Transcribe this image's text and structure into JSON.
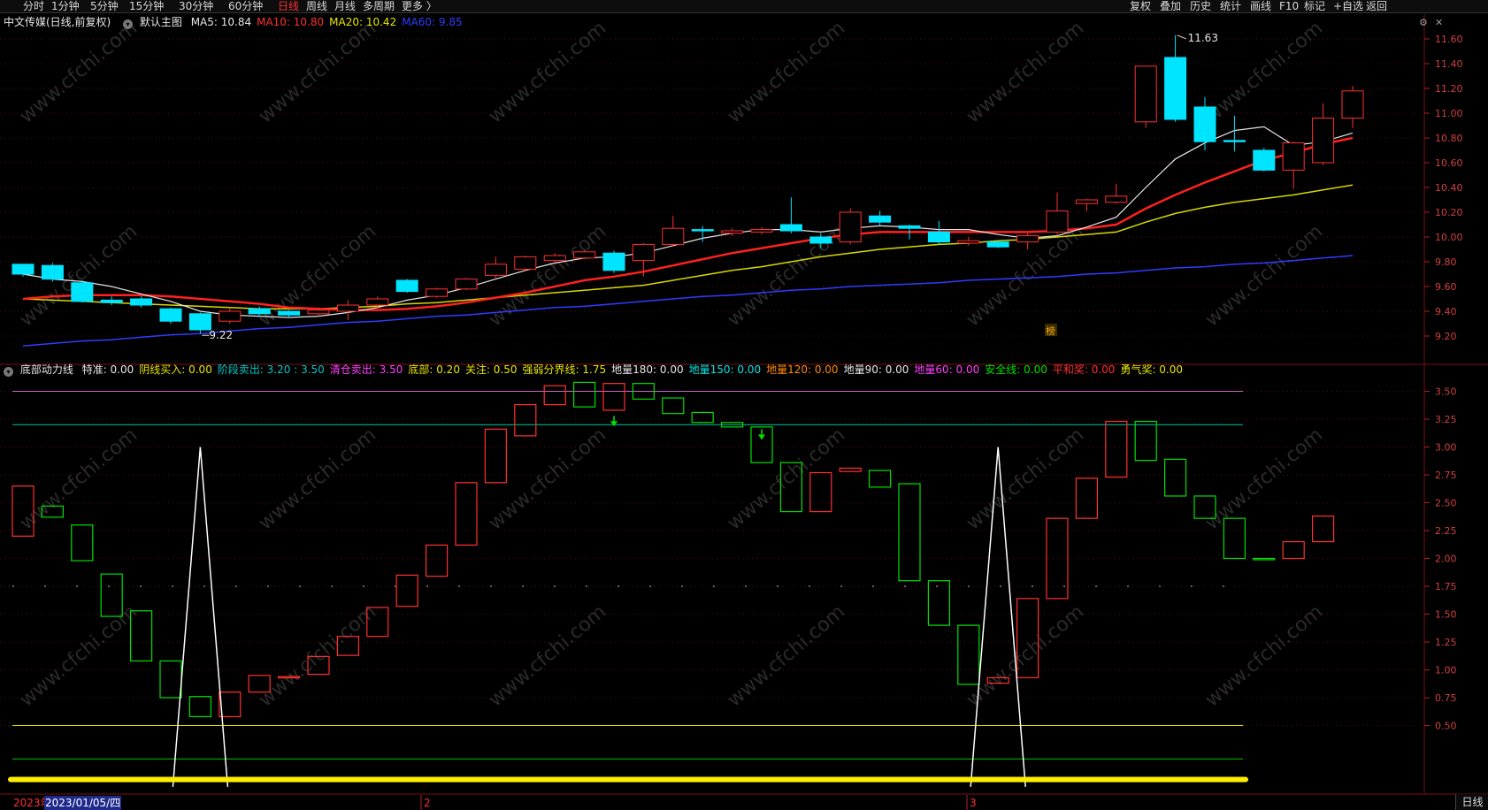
{
  "toolbar": {
    "periods": [
      "分时",
      "1分钟",
      "5分钟",
      "15分钟",
      "30分钟",
      "60分钟",
      "日线",
      "周线",
      "月线",
      "多周期",
      "更多 〉"
    ],
    "active_period": "日线",
    "right": [
      "复权",
      "叠加",
      "历史",
      "统计",
      "画线",
      "F10",
      "标记",
      "+自选",
      "返回"
    ]
  },
  "info": {
    "title": "中文传媒(日线,前复权)",
    "template": "默认主图",
    "ma": [
      {
        "label": "MA5: 10.84",
        "color": "#e6e6e6"
      },
      {
        "label": "MA10: 10.80",
        "color": "#ff3030"
      },
      {
        "label": "MA20: 10.42",
        "color": "#e6e600"
      },
      {
        "label": "MA60: 9.85",
        "color": "#2f3cff"
      }
    ]
  },
  "indicator": {
    "name": "底部动力线",
    "items": [
      {
        "label": "特准: 0.00",
        "color": "#e6e6e6"
      },
      {
        "label": "阴线买入: 0.00",
        "color": "#e6e600"
      },
      {
        "label": "阶段卖出: 3.20 : 3.50",
        "color": "#00c8c8"
      },
      {
        "label": "清仓卖出: 3.50",
        "color": "#ff40ff"
      },
      {
        "label": "底部: 0.20",
        "color": "#e6e600"
      },
      {
        "label": "关注: 0.50",
        "color": "#e6e600"
      },
      {
        "label": "强弱分界线: 1.75",
        "color": "#e6e600"
      },
      {
        "label": "地量180: 0.00",
        "color": "#e6e6e6"
      },
      {
        "label": "地量150: 0.00",
        "color": "#00e5e5"
      },
      {
        "label": "地量120: 0.00",
        "color": "#ff8c00"
      },
      {
        "label": "地量90: 0.00",
        "color": "#e6e6e6"
      },
      {
        "label": "地量60: 0.00",
        "color": "#ff40ff"
      },
      {
        "label": "安全线: 0.00",
        "color": "#00e000"
      },
      {
        "label": "平和奖: 0.00",
        "color": "#ff3030"
      },
      {
        "label": "勇气奖: 0.00",
        "color": "#e6e600"
      }
    ]
  },
  "price_axis": [
    "11.60",
    "11.40",
    "11.20",
    "11.00",
    "10.80",
    "10.60",
    "10.40",
    "10.20",
    "10.00",
    "9.80",
    "9.60",
    "9.40",
    "9.20"
  ],
  "ind_axis": [
    "3.50",
    "3.25",
    "3.00",
    "2.75",
    "2.50",
    "2.25",
    "2.00",
    "1.75",
    "1.50",
    "1.25",
    "1.00",
    "0.75",
    "0.50"
  ],
  "annotations": {
    "high": "11.63",
    "low": "9.22",
    "badge": "榜"
  },
  "dates": {
    "year": "2023年",
    "cursor": "2023/01/05/四",
    "m2": "2",
    "m3": "3"
  },
  "period_label": "日线",
  "watermark": "www.cfchi.com",
  "colors": {
    "up": "#ff3030",
    "down": "#00e5ff",
    "ind_up": "#ff3030",
    "ind_down": "#00e000",
    "grid": "#7a1010"
  },
  "chart_data": {
    "type": "candlestick",
    "candles": [
      {
        "o": 9.78,
        "c": 9.7,
        "h": 9.78,
        "l": 9.68
      },
      {
        "o": 9.77,
        "c": 9.66,
        "h": 9.79,
        "l": 9.64
      },
      {
        "o": 9.63,
        "c": 9.48,
        "h": 9.65,
        "l": 9.47
      },
      {
        "o": 9.49,
        "c": 9.47,
        "h": 9.52,
        "l": 9.45
      },
      {
        "o": 9.5,
        "c": 9.45,
        "h": 9.52,
        "l": 9.43
      },
      {
        "o": 9.42,
        "c": 9.32,
        "h": 9.43,
        "l": 9.3
      },
      {
        "o": 9.38,
        "c": 9.25,
        "h": 9.39,
        "l": 9.22
      },
      {
        "o": 9.32,
        "c": 9.4,
        "h": 9.43,
        "l": 9.3
      },
      {
        "o": 9.42,
        "c": 9.38,
        "h": 9.44,
        "l": 9.36
      },
      {
        "o": 9.4,
        "c": 9.37,
        "h": 9.41,
        "l": 9.35
      },
      {
        "o": 9.38,
        "c": 9.41,
        "h": 9.43,
        "l": 9.36
      },
      {
        "o": 9.4,
        "c": 9.45,
        "h": 9.49,
        "l": 9.33
      },
      {
        "o": 9.45,
        "c": 9.5,
        "h": 9.52,
        "l": 9.42
      },
      {
        "o": 9.65,
        "c": 9.56,
        "h": 9.66,
        "l": 9.55
      },
      {
        "o": 9.52,
        "c": 9.58,
        "h": 9.59,
        "l": 9.51
      },
      {
        "o": 9.58,
        "c": 9.66,
        "h": 9.67,
        "l": 9.57
      },
      {
        "o": 9.69,
        "c": 9.78,
        "h": 9.84,
        "l": 9.66
      },
      {
        "o": 9.74,
        "c": 9.84,
        "h": 9.85,
        "l": 9.72
      },
      {
        "o": 9.81,
        "c": 9.85,
        "h": 9.87,
        "l": 9.79
      },
      {
        "o": 9.83,
        "c": 9.88,
        "h": 9.89,
        "l": 9.82
      },
      {
        "o": 9.87,
        "c": 9.73,
        "h": 9.89,
        "l": 9.71
      },
      {
        "o": 9.81,
        "c": 9.94,
        "h": 9.95,
        "l": 9.68
      },
      {
        "o": 9.94,
        "c": 10.07,
        "h": 10.17,
        "l": 9.92
      },
      {
        "o": 10.06,
        "c": 10.05,
        "h": 10.09,
        "l": 9.96
      },
      {
        "o": 10.03,
        "c": 10.05,
        "h": 10.07,
        "l": 10.01
      },
      {
        "o": 10.04,
        "c": 10.06,
        "h": 10.08,
        "l": 10.02
      },
      {
        "o": 10.1,
        "c": 10.05,
        "h": 10.32,
        "l": 10.03
      },
      {
        "o": 10.0,
        "c": 9.95,
        "h": 10.03,
        "l": 9.91
      },
      {
        "o": 9.96,
        "c": 10.2,
        "h": 10.23,
        "l": 9.94
      },
      {
        "o": 10.17,
        "c": 10.12,
        "h": 10.21,
        "l": 10.09
      },
      {
        "o": 10.09,
        "c": 10.07,
        "h": 10.1,
        "l": 9.98
      },
      {
        "o": 10.04,
        "c": 9.96,
        "h": 10.13,
        "l": 9.94
      },
      {
        "o": 9.95,
        "c": 9.97,
        "h": 10.0,
        "l": 9.93
      },
      {
        "o": 9.96,
        "c": 9.92,
        "h": 9.97,
        "l": 9.91
      },
      {
        "o": 9.96,
        "c": 10.01,
        "h": 10.03,
        "l": 9.9
      },
      {
        "o": 10.04,
        "c": 10.21,
        "h": 10.36,
        "l": 10.02
      },
      {
        "o": 10.27,
        "c": 10.3,
        "h": 10.31,
        "l": 10.21
      },
      {
        "o": 10.28,
        "c": 10.33,
        "h": 10.43,
        "l": 10.27
      },
      {
        "o": 10.93,
        "c": 11.38,
        "h": 11.38,
        "l": 10.88
      },
      {
        "o": 11.45,
        "c": 10.95,
        "h": 11.63,
        "l": 10.93
      },
      {
        "o": 11.05,
        "c": 10.77,
        "h": 11.13,
        "l": 10.7
      },
      {
        "o": 10.78,
        "c": 10.77,
        "h": 10.98,
        "l": 10.69
      },
      {
        "o": 10.7,
        "c": 10.54,
        "h": 10.72,
        "l": 10.53
      },
      {
        "o": 10.54,
        "c": 10.76,
        "h": 10.77,
        "l": 10.39
      },
      {
        "o": 10.6,
        "c": 10.96,
        "h": 11.08,
        "l": 10.58
      },
      {
        "o": 10.96,
        "c": 11.18,
        "h": 11.22,
        "l": 10.88
      }
    ],
    "ma5": [
      9.7,
      9.66,
      9.64,
      9.6,
      9.54,
      9.48,
      9.4,
      9.37,
      9.36,
      9.35,
      9.36,
      9.39,
      9.43,
      9.49,
      9.53,
      9.59,
      9.66,
      9.73,
      9.79,
      9.83,
      9.84,
      9.87,
      9.93,
      9.99,
      10.03,
      10.06,
      10.06,
      10.04,
      10.07,
      10.09,
      10.08,
      10.06,
      10.06,
      10.02,
      9.99,
      10.01,
      10.08,
      10.16,
      10.4,
      10.63,
      10.76,
      10.86,
      10.89,
      10.74,
      10.77,
      10.84
    ],
    "ma10": [
      9.5,
      9.52,
      9.53,
      9.53,
      9.53,
      9.52,
      9.5,
      9.48,
      9.46,
      9.43,
      9.42,
      9.41,
      9.41,
      9.42,
      9.44,
      9.47,
      9.51,
      9.55,
      9.6,
      9.65,
      9.68,
      9.72,
      9.77,
      9.82,
      9.87,
      9.91,
      9.95,
      9.99,
      10.02,
      10.04,
      10.04,
      10.04,
      10.04,
      10.04,
      10.04,
      10.05,
      10.07,
      10.1,
      10.23,
      10.34,
      10.44,
      10.53,
      10.62,
      10.68,
      10.75,
      10.8
    ],
    "ma20": [
      9.5,
      9.49,
      9.48,
      9.47,
      9.46,
      9.45,
      9.44,
      9.43,
      9.42,
      9.42,
      9.42,
      9.43,
      9.44,
      9.46,
      9.47,
      9.49,
      9.51,
      9.53,
      9.55,
      9.57,
      9.59,
      9.61,
      9.65,
      9.69,
      9.73,
      9.76,
      9.8,
      9.84,
      9.87,
      9.9,
      9.92,
      9.94,
      9.95,
      9.97,
      9.98,
      10.0,
      10.02,
      10.04,
      10.12,
      10.19,
      10.24,
      10.28,
      10.31,
      10.34,
      10.38,
      10.42
    ],
    "ma60": [
      9.12,
      9.14,
      9.16,
      9.17,
      9.19,
      9.21,
      9.22,
      9.24,
      9.26,
      9.27,
      9.29,
      9.31,
      9.32,
      9.34,
      9.36,
      9.37,
      9.39,
      9.41,
      9.43,
      9.44,
      9.46,
      9.48,
      9.5,
      9.52,
      9.53,
      9.55,
      9.57,
      9.58,
      9.6,
      9.61,
      9.62,
      9.63,
      9.65,
      9.66,
      9.67,
      9.68,
      9.7,
      9.71,
      9.73,
      9.75,
      9.76,
      9.78,
      9.79,
      9.81,
      9.83,
      9.85
    ],
    "indicator_boxes": [
      [
        2.2,
        2.65
      ],
      [
        2.37,
        2.47
      ],
      [
        1.98,
        2.3
      ],
      [
        1.48,
        1.86
      ],
      [
        1.08,
        1.53
      ],
      [
        0.75,
        1.08
      ],
      [
        0.58,
        0.76
      ],
      [
        0.58,
        0.8
      ],
      [
        0.8,
        0.95
      ],
      [
        0.93,
        0.94
      ],
      [
        0.96,
        1.12
      ],
      [
        1.13,
        1.3
      ],
      [
        1.3,
        1.56
      ],
      [
        1.57,
        1.85
      ],
      [
        1.84,
        2.12
      ],
      [
        2.12,
        2.68
      ],
      [
        2.68,
        3.16
      ],
      [
        3.1,
        3.38
      ],
      [
        3.38,
        3.55
      ],
      [
        3.36,
        3.58
      ],
      [
        3.33,
        3.57
      ],
      [
        3.43,
        3.57
      ],
      [
        3.3,
        3.44
      ],
      [
        3.22,
        3.31
      ],
      [
        3.18,
        3.22
      ],
      [
        2.86,
        3.18
      ],
      [
        2.42,
        2.86
      ],
      [
        2.42,
        2.77
      ],
      [
        2.78,
        2.81
      ],
      [
        2.64,
        2.79
      ],
      [
        1.8,
        2.67
      ],
      [
        1.4,
        1.8
      ],
      [
        0.87,
        1.4
      ],
      [
        0.88,
        0.93
      ],
      [
        0.93,
        1.64
      ],
      [
        1.64,
        2.36
      ],
      [
        2.36,
        2.72
      ],
      [
        2.73,
        3.23
      ],
      [
        2.88,
        3.23
      ],
      [
        2.56,
        2.89
      ],
      [
        2.36,
        2.56
      ],
      [
        2.0,
        2.36
      ],
      [
        2.0,
        2.0
      ],
      [
        2.0,
        2.15
      ],
      [
        2.15,
        2.38
      ]
    ],
    "indicator_up": [
      1,
      0,
      0,
      0,
      0,
      0,
      0,
      1,
      1,
      1,
      1,
      1,
      1,
      1,
      1,
      1,
      1,
      1,
      1,
      0,
      1,
      0,
      0,
      0,
      0,
      0,
      0,
      1,
      1,
      0,
      0,
      0,
      0,
      1,
      1,
      1,
      1,
      1,
      0,
      0,
      0,
      0,
      0,
      1,
      1
    ],
    "spikes": [
      6,
      33
    ],
    "levels": [
      {
        "value": 3.5,
        "color": "#c86ec8"
      },
      {
        "value": 3.2,
        "color": "#00c8a0"
      },
      {
        "value": 1.75,
        "color": "#aaaaaa"
      },
      {
        "value": 0.5,
        "color": "#e6e600"
      },
      {
        "value": 0.2,
        "color": "#00c000"
      }
    ]
  }
}
